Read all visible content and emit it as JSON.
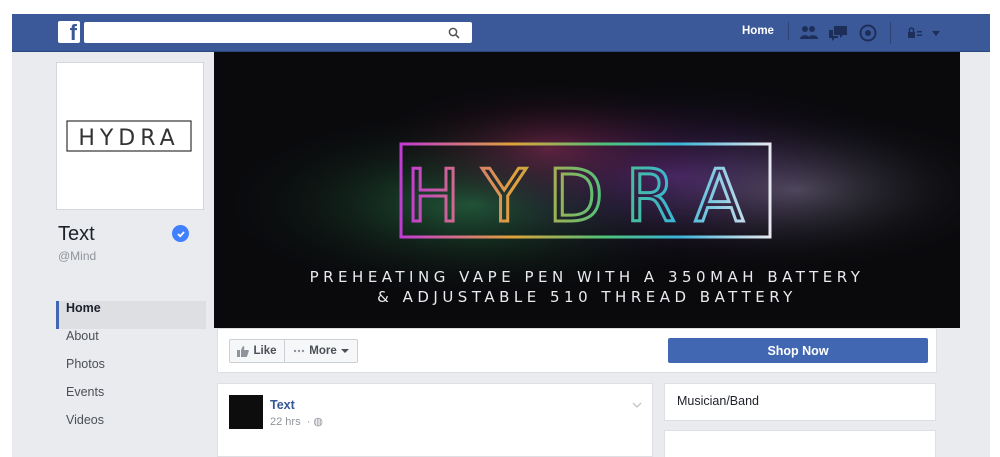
{
  "topbar": {
    "logo": "f",
    "search": {
      "value": "",
      "placeholder": ""
    },
    "nav": {
      "home_label": "Home"
    },
    "icons": [
      "friend-requests-icon",
      "messages-icon",
      "notifications-icon",
      "privacy-shortcuts-icon",
      "account-menu-icon"
    ]
  },
  "page": {
    "name": "Text",
    "handle": "@Mind",
    "verified": true,
    "profile_logo": "HYDRA"
  },
  "sidebar": {
    "items": [
      {
        "label": "Home",
        "active": true
      },
      {
        "label": "About"
      },
      {
        "label": "Photos"
      },
      {
        "label": "Events"
      },
      {
        "label": "Videos"
      }
    ]
  },
  "cover": {
    "logo": "HYDRA",
    "tagline_line1": "PREHEATING VAPE PEN WITH A 350MAH BATTERY",
    "tagline_line2": "& ADJUSTABLE 510 THREAD BATTERY"
  },
  "actions": {
    "like_label": "Like",
    "more_label": "More",
    "shop_label": "Shop Now"
  },
  "post": {
    "author": "Text",
    "time": "22 hrs"
  },
  "about": {
    "category": "Musician/Band"
  },
  "colors": {
    "brand": "#3b5998",
    "button_blue": "#4267b2",
    "background": "#e9ebee",
    "verified": "#4080ff"
  }
}
